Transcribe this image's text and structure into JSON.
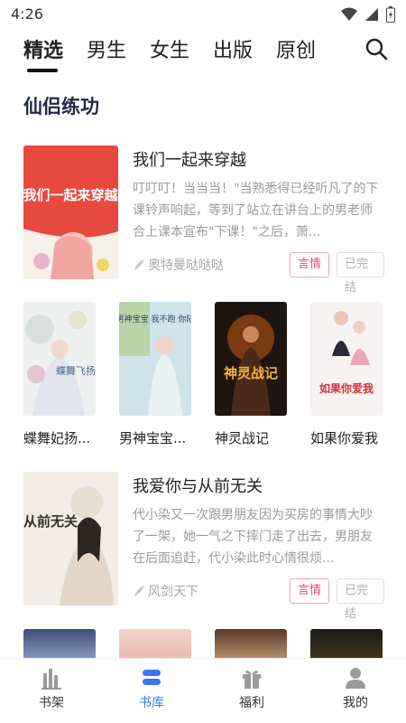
{
  "status_bar": {
    "time": "4:26",
    "icons": [
      "wifi-icon",
      "signal-icon",
      "battery-icon"
    ]
  },
  "top_nav": {
    "tabs": [
      {
        "label": "精选",
        "active": true
      },
      {
        "label": "男生",
        "active": false
      },
      {
        "label": "女生",
        "active": false
      },
      {
        "label": "出版",
        "active": false
      },
      {
        "label": "原创",
        "active": false
      }
    ],
    "search_icon": "search-icon"
  },
  "section": {
    "title": "仙侣练功"
  },
  "featured": [
    {
      "title": "我们一起来穿越",
      "description": "叮叮叮！当当当！\"当熟悉得已经听凡了的下课铃声响起，等到了站立在讲台上的男老师合上课本宣布\"下课！\"之后，萧...",
      "author": "奥特曼哒哒哒",
      "genre": "言情",
      "status": "已完结",
      "cover_text": "我们一起来穿越"
    },
    {
      "title": "我爱你与从前无关",
      "description": "代小染又一次跟男朋友因为买房的事情大吵了一架，她一气之下摔门走了出去，男朋友在后面追赶，代小染此时心情很烦...",
      "author": "风剑天下",
      "genre": "言情",
      "status": "已完结",
      "cover_text": "从前无关"
    }
  ],
  "grid": [
    {
      "title": "蝶舞妃扬...",
      "cover_text": "蝶舞飞扬"
    },
    {
      "title": "男神宝宝...",
      "cover_text": "男神宝宝 我不跑 你陆"
    },
    {
      "title": "神灵战记",
      "cover_text": "神灵战记"
    },
    {
      "title": "如果你爱我",
      "cover_text": "如果你爱我"
    }
  ],
  "bottom_nav": [
    {
      "label": "书架",
      "icon": "bookshelf-icon",
      "active": false
    },
    {
      "label": "书库",
      "icon": "library-icon",
      "active": true
    },
    {
      "label": "福利",
      "icon": "gift-icon",
      "active": false
    },
    {
      "label": "我的",
      "icon": "profile-icon",
      "active": false
    }
  ],
  "colors": {
    "accent": "#3f73f5",
    "genre_tag": "#e0506e",
    "section_title": "#1f2a44"
  }
}
